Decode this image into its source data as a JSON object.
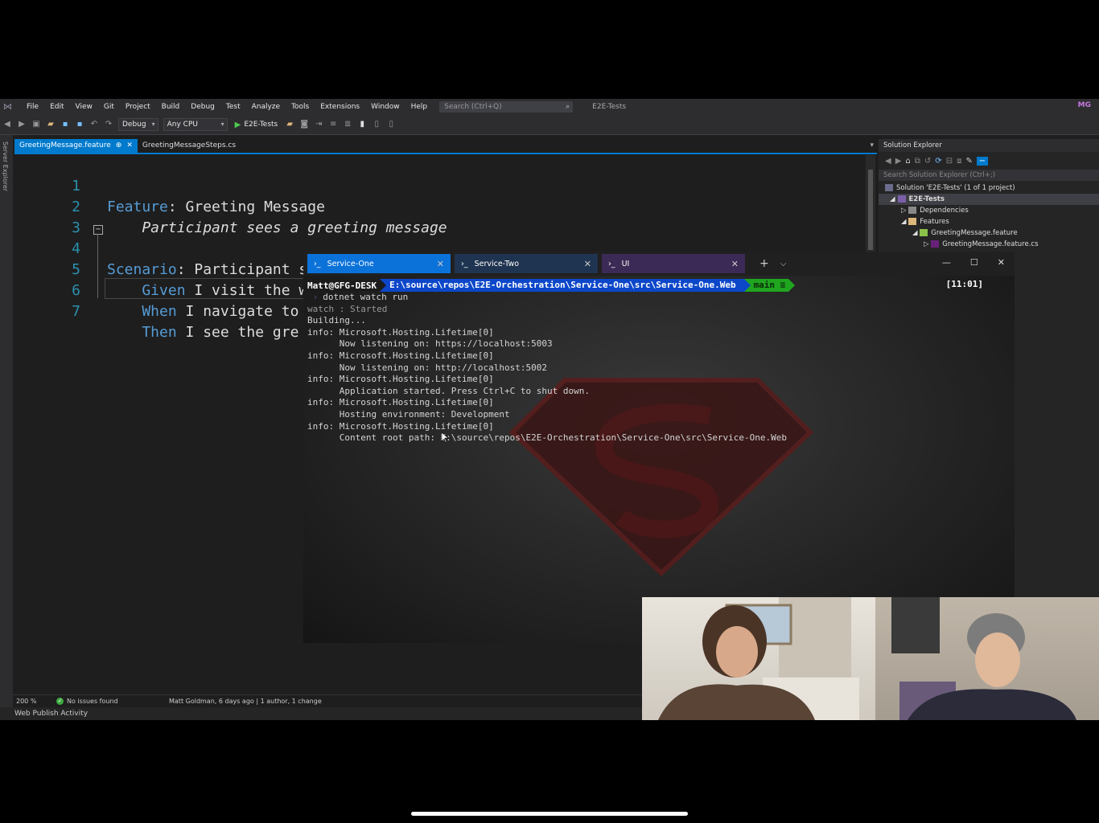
{
  "menu": {
    "items": [
      "File",
      "Edit",
      "View",
      "Git",
      "Project",
      "Build",
      "Debug",
      "Test",
      "Analyze",
      "Tools",
      "Extensions",
      "Window",
      "Help"
    ],
    "search_placeholder": "Search (Ctrl+Q)",
    "solution_name": "E2E-Tests",
    "avatar": "MG"
  },
  "toolbar": {
    "config": "Debug",
    "platform": "Any CPU",
    "run_target": "E2E-Tests"
  },
  "side_panel": {
    "label": "Server Explorer"
  },
  "doc_tabs": [
    {
      "label": "GreetingMessage.feature",
      "active": true
    },
    {
      "label": "GreetingMessageSteps.cs",
      "active": false
    }
  ],
  "editor": {
    "lines": [
      {
        "n": "1",
        "kw": "Feature",
        "rest": ": Greeting Message"
      },
      {
        "n": "2",
        "text": "    Participant sees a greeting message"
      },
      {
        "n": "3",
        "text": ""
      },
      {
        "n": "4",
        "kw": "Scenario",
        "rest": ": Participant sees a greeting message"
      },
      {
        "n": "5",
        "kw": "    Given",
        "rest": " I visit the website"
      },
      {
        "n": "6",
        "kw": "    When",
        "rest": " I navigate to"
      },
      {
        "n": "7",
        "kw": "    Then",
        "rest": " I see the gre"
      }
    ]
  },
  "status": {
    "zoom": "200 %",
    "issues": "No issues found",
    "blame": "Matt Goldman, 6 days ago | 1 author, 1 change",
    "web_publish": "Web Publish Activity"
  },
  "solution_explorer": {
    "title": "Solution Explorer",
    "search": "Search Solution Explorer (Ctrl+;)",
    "tree": [
      {
        "label": "Solution 'E2E-Tests' (1 of 1 project)",
        "indent": 0
      },
      {
        "label": "E2E-Tests",
        "indent": 1,
        "bold": true
      },
      {
        "label": "Dependencies",
        "indent": 2
      },
      {
        "label": "Features",
        "indent": 2
      },
      {
        "label": "GreetingMessage.feature",
        "indent": 3
      },
      {
        "label": "GreetingMessage.feature.cs",
        "indent": 4
      }
    ]
  },
  "terminal": {
    "tabs": [
      "Service-One",
      "Service-Two",
      "UI"
    ],
    "prompt": {
      "user": "Matt@GFG-DESK",
      "path": "E:\\source\\repos\\E2E-Orchestration\\Service-One\\src\\Service-One.Web",
      "git": "main ≡",
      "time": "[11:01]"
    },
    "command": "dotnet watch run",
    "output": [
      "watch : Started",
      "Building...",
      "info: Microsoft.Hosting.Lifetime[0]",
      "      Now listening on: https://localhost:5003",
      "info: Microsoft.Hosting.Lifetime[0]",
      "      Now listening on: http://localhost:5002",
      "info: Microsoft.Hosting.Lifetime[0]",
      "      Application started. Press Ctrl+C to shut down.",
      "info: Microsoft.Hosting.Lifetime[0]",
      "      Hosting environment: Development",
      "info: Microsoft.Hosting.Lifetime[0]",
      "      Content root path: E:\\source\\repos\\E2E-Orchestration\\Service-One\\src\\Service-One.Web"
    ]
  }
}
